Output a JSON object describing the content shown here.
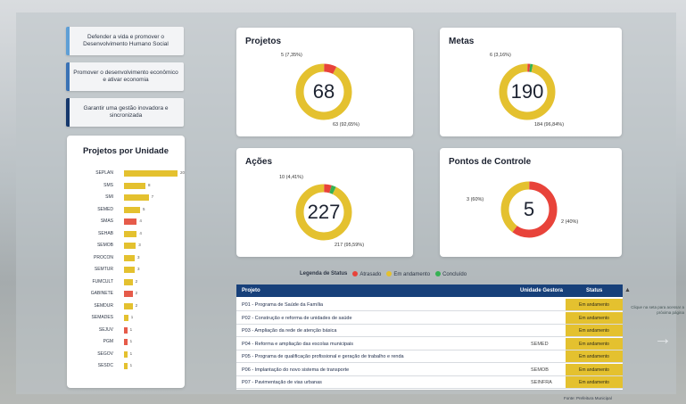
{
  "strategies": [
    {
      "label": "Defender a vida e promover o Desenvolvimento Humano Social"
    },
    {
      "label": "Promover o desenvolvimento econômico e ativar economia"
    },
    {
      "label": "Garantir uma gestão inovadora e sincronizada"
    }
  ],
  "units_panel": {
    "title": "Projetos por Unidade",
    "rows": [
      {
        "name": "SEPLAN",
        "value": "20",
        "fraction": 1.0,
        "color": "#e4c12f"
      },
      {
        "name": "SMS",
        "value": "8",
        "fraction": 0.4,
        "color": "#e4c12f"
      },
      {
        "name": "SMI",
        "value": "7",
        "fraction": 0.46,
        "color": "#e4c12f"
      },
      {
        "name": "SEMED",
        "value": "5",
        "fraction": 0.3,
        "color": "#e4c12f"
      },
      {
        "name": "SMAS",
        "value": "4",
        "fraction": 0.24,
        "color": "#e65b4a"
      },
      {
        "name": "SEHAB",
        "value": "4",
        "fraction": 0.24,
        "color": "#e4c12f"
      },
      {
        "name": "SEMOB",
        "value": "3",
        "fraction": 0.22,
        "color": "#e4c12f"
      },
      {
        "name": "PROCON",
        "value": "3",
        "fraction": 0.2,
        "color": "#e4c12f"
      },
      {
        "name": "SEMTUR",
        "value": "3",
        "fraction": 0.2,
        "color": "#e4c12f"
      },
      {
        "name": "FUMCULT",
        "value": "2",
        "fraction": 0.16,
        "color": "#e4c12f"
      },
      {
        "name": "GABINETE",
        "value": "2",
        "fraction": 0.16,
        "color": "#e65b4a"
      },
      {
        "name": "SEMDUR",
        "value": "2",
        "fraction": 0.16,
        "color": "#e4c12f"
      },
      {
        "name": "SEMADES",
        "value": "1",
        "fraction": 0.08,
        "color": "#e4c12f"
      },
      {
        "name": "SEJUV",
        "value": "1",
        "fraction": 0.06,
        "color": "#e65b4a"
      },
      {
        "name": "PGM",
        "value": "1",
        "fraction": 0.06,
        "color": "#e65b4a"
      },
      {
        "name": "SEGOV",
        "value": "1",
        "fraction": 0.06,
        "color": "#e4c12f"
      },
      {
        "name": "SESDC",
        "value": "1",
        "fraction": 0.06,
        "color": "#e4c12f"
      }
    ]
  },
  "kpis": {
    "projetos": {
      "title": "Projetos",
      "total": "68",
      "top_label": "5 (7,35%)",
      "bottom_label": "63 (92,65%)",
      "segments": [
        {
          "status": "Atrasado",
          "fraction": 0.0735
        },
        {
          "status": "Em andamento",
          "fraction": 0.9265
        }
      ]
    },
    "metas": {
      "title": "Metas",
      "total": "190",
      "top_label": "6 (3,16%)",
      "bottom_label": "184 (96,84%)",
      "segments": [
        {
          "status": "Atrasado",
          "fraction": 0.0158
        },
        {
          "status": "Concluído",
          "fraction": 0.0158
        },
        {
          "status": "Em andamento",
          "fraction": 0.9684
        }
      ]
    },
    "acoes": {
      "title": "Ações",
      "total": "227",
      "top_label": "10 (4,41%)",
      "bottom_label": "217 (95,59%)",
      "segments": [
        {
          "status": "Atrasado",
          "fraction": 0.044
        },
        {
          "status": "Concluído",
          "fraction": 0.0264
        },
        {
          "status": "Em andamento",
          "fraction": 0.9296
        }
      ]
    },
    "pontos": {
      "title": "Pontos de Controle",
      "total": "5",
      "left_label": "3 (60%)",
      "right_label": "2 (40%)",
      "segments": [
        {
          "status": "Atrasado",
          "fraction": 0.6
        },
        {
          "status": "Em andamento",
          "fraction": 0.4
        }
      ]
    }
  },
  "legend": {
    "title": "Legenda de Status",
    "items": [
      {
        "label": "Atrasado",
        "color": "#e8433a"
      },
      {
        "label": "Em andamento",
        "color": "#e4c12f"
      },
      {
        "label": "Concluído",
        "color": "#35b153"
      }
    ]
  },
  "table": {
    "headers": {
      "project": "Projeto",
      "unit": "Unidade Gestora",
      "status": "Status"
    },
    "rows": [
      {
        "project": "P01 - Programa de Saúde da Família",
        "unit": "",
        "status": "Em andamento"
      },
      {
        "project": "P02 - Construção e reforma de unidades de saúde",
        "unit": "",
        "status": "Em andamento"
      },
      {
        "project": "P03 - Ampliação da rede de atenção básica",
        "unit": "",
        "status": "Em andamento"
      },
      {
        "project": "P04 - Reforma e ampliação das escolas municipais",
        "unit": "SEMED",
        "status": "Em andamento"
      },
      {
        "project": "P05 - Programa de qualificação profissional e geração de trabalho e renda",
        "unit": "",
        "status": "Em andamento"
      },
      {
        "project": "P06 - Implantação do novo sistema de transporte",
        "unit": "SEMOB",
        "status": "Em andamento"
      },
      {
        "project": "P07 - Pavimentação de vias urbanas",
        "unit": "SEINFRA",
        "status": "Em andamento"
      }
    ]
  },
  "side_note": "Clique na seta para acessar a próxima página",
  "footnote": "Fonte: Prefeitura Municipal"
}
